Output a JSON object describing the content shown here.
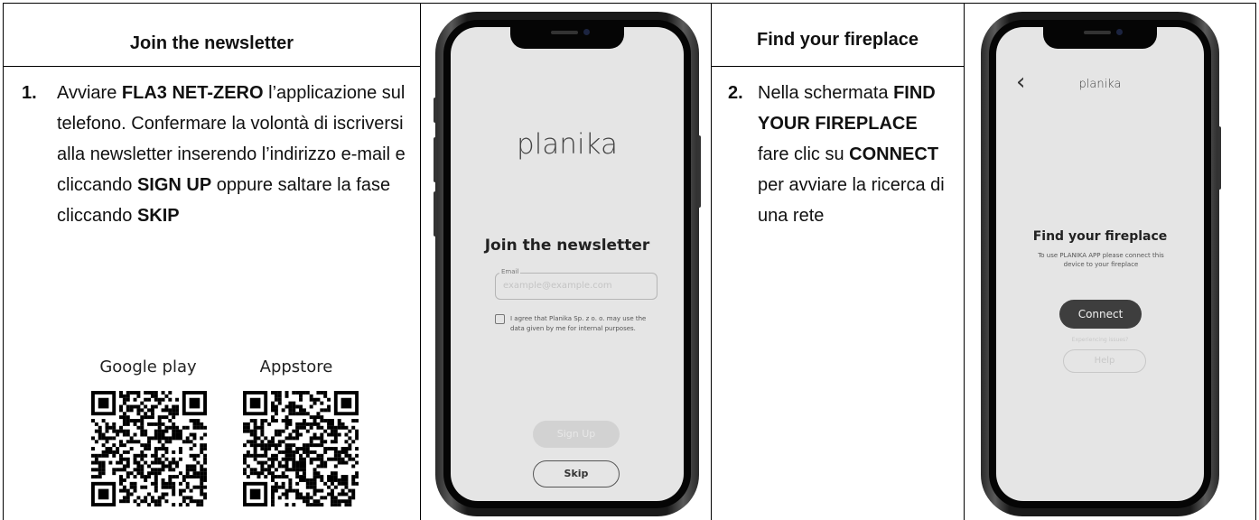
{
  "col1": {
    "header": "Join the newsletter",
    "step_number": "1.",
    "step_parts": [
      {
        "text": "Avviare ",
        "bold": false
      },
      {
        "text": "FLA3 NET-ZERO",
        "bold": true
      },
      {
        "text": " l’applicazione sul telefono. Confermare la volontà di iscriversi alla newsletter inserendo l’indirizzo e-mail e cliccando ",
        "bold": false
      },
      {
        "text": "SIGN UP",
        "bold": true
      },
      {
        "text": " oppure saltare la fase cliccando ",
        "bold": false
      },
      {
        "text": "SKIP",
        "bold": true
      }
    ],
    "store_google": "Google play",
    "store_apple": "Appstore"
  },
  "phone1": {
    "logo": "planika",
    "title": "Join the newsletter",
    "email_label": "Email",
    "email_placeholder": "example@example.com",
    "agree_text": "I agree that Planika Sp. z o. o. may use the data given by me for internal purposes.",
    "signup_label": "Sign Up",
    "skip_label": "Skip"
  },
  "col3": {
    "header": "Find your fireplace",
    "step_number": "2.",
    "step_parts": [
      {
        "text": "Nella schermata ",
        "bold": false
      },
      {
        "text": "FIND YOUR FIREPLACE",
        "bold": true
      },
      {
        "text": " fare clic su ",
        "bold": false
      },
      {
        "text": "CONNECT",
        "bold": true
      },
      {
        "text": " per avviare la ricerca di una rete",
        "bold": false
      }
    ]
  },
  "phone2": {
    "back_glyph": "‹",
    "logo": "planika",
    "title": "Find your fireplace",
    "subtitle": "To use PLANIKA APP please connect this device to your fireplace",
    "connect_label": "Connect",
    "issues_text": "Experiencing issues?",
    "help_label": "Help"
  }
}
